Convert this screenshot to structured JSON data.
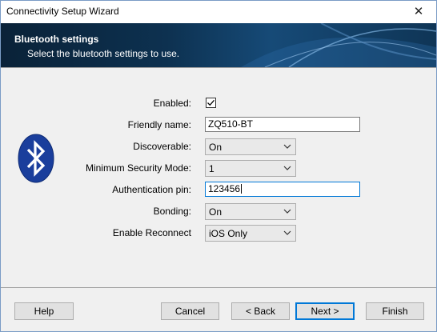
{
  "window": {
    "title": "Connectivity Setup Wizard",
    "close_glyph": "✕"
  },
  "banner": {
    "heading": "Bluetooth settings",
    "subheading": "Select the bluetooth settings to use."
  },
  "icon": {
    "name": "bluetooth-icon",
    "color": "#1a3e9c"
  },
  "form": {
    "enabled": {
      "label": "Enabled:",
      "checked": true,
      "mark": "✓"
    },
    "friendly_name": {
      "label": "Friendly name:",
      "value": "ZQ510-BT"
    },
    "discoverable": {
      "label": "Discoverable:",
      "value": "On"
    },
    "min_security": {
      "label": "Minimum Security Mode:",
      "value": "1"
    },
    "auth_pin": {
      "label": "Authentication pin:",
      "value": "123456"
    },
    "bonding": {
      "label": "Bonding:",
      "value": "On"
    },
    "reconnect": {
      "label": "Enable Reconnect",
      "value": "iOS Only"
    }
  },
  "buttons": {
    "help": "Help",
    "cancel": "Cancel",
    "back": "< Back",
    "next": "Next >",
    "finish": "Finish"
  }
}
